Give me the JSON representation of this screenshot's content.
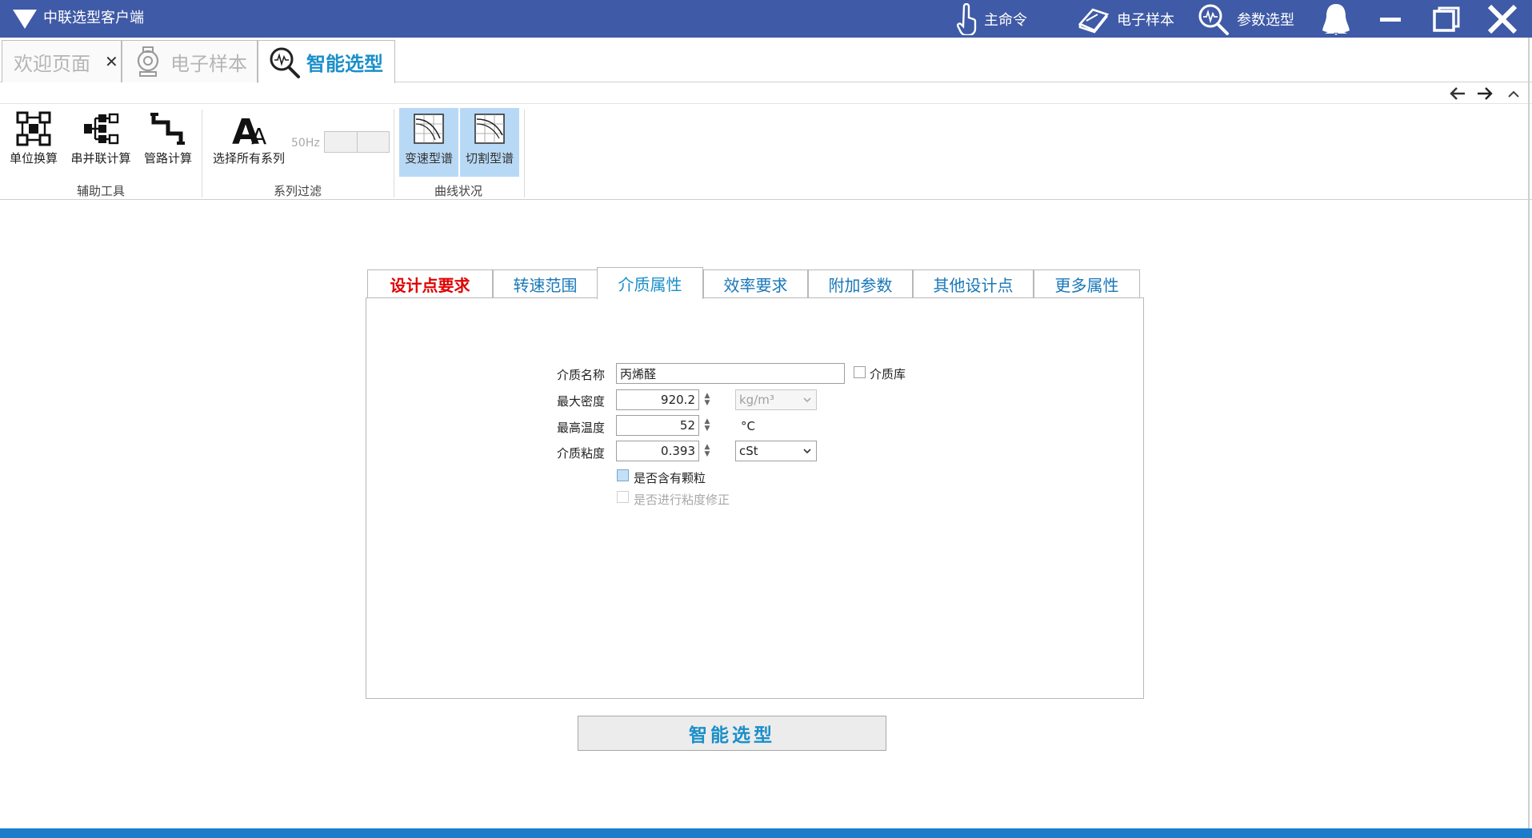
{
  "window": {
    "title": "中联选型客户端",
    "commands": [
      {
        "label": "主命令",
        "icon": "touch-hand-icon"
      },
      {
        "label": "电子样本",
        "icon": "book-icon"
      },
      {
        "label": "参数选型",
        "icon": "search-chart-icon"
      }
    ],
    "buttons": [
      "user-icon",
      "minimize-icon",
      "maximize-icon",
      "close-icon"
    ]
  },
  "doc_tabs": [
    {
      "label": "欢迎页面",
      "closable": true,
      "active": false
    },
    {
      "label": "电子样本",
      "icon": "pump-icon",
      "active": false
    },
    {
      "label": "智能选型",
      "icon": "search-chart-icon",
      "active": true
    }
  ],
  "ribbon": {
    "groups": [
      {
        "label": "辅助工具",
        "items": [
          "单位换算",
          "串并联计算",
          "管路计算"
        ]
      },
      {
        "label": "系列过滤",
        "items": [
          "选择所有系列"
        ],
        "toggle_label": "50Hz"
      },
      {
        "label": "曲线状况",
        "items": [
          "变速型谱",
          "切割型谱"
        ]
      }
    ]
  },
  "prop_tabs": [
    "设计点要求",
    "转速范围",
    "介质属性",
    "效率要求",
    "附加参数",
    "其他设计点",
    "更多属性"
  ],
  "active_prop_tab": "介质属性",
  "medium": {
    "name_label": "介质名称",
    "name_value": "丙烯醛",
    "library_label": "介质库",
    "density_label": "最大密度",
    "density_value": "920.2",
    "density_unit": "kg/m³",
    "temp_label": "最高温度",
    "temp_value": "52",
    "temp_unit": "°C",
    "viscosity_label": "介质粘度",
    "viscosity_value": "0.393",
    "viscosity_unit": "cSt",
    "particles_label": "是否含有颗粒",
    "viscosity_correction_label": "是否进行粘度修正"
  },
  "action_button": "智能选型",
  "colors": {
    "titlebar": "#3f5aa6",
    "accent": "#1a8fc9",
    "alert_tab": "#e00000",
    "ribbon_selected": "#b8d9f5",
    "statusbar": "#1b7ccc"
  }
}
